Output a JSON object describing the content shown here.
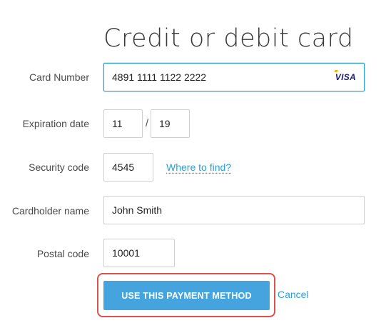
{
  "form": {
    "title": "Credit or debit card",
    "card_number": {
      "label": "Card Number",
      "value": "4891 1111 1122 2222",
      "brand": "VISA"
    },
    "expiration": {
      "label": "Expiration date",
      "month": "11",
      "separator": "/",
      "year": "19"
    },
    "security_code": {
      "label": "Security code",
      "value": "4545",
      "help_link": "Where to find?"
    },
    "cardholder": {
      "label": "Cardholder name",
      "value": "John Smith"
    },
    "postal": {
      "label": "Postal code",
      "value": "10001"
    },
    "actions": {
      "submit_label": "USE THIS PAYMENT METHOD",
      "cancel_label": "Cancel"
    }
  },
  "colors": {
    "accent": "#45a4dd",
    "link": "#2a9fd8",
    "highlight": "#d9534f",
    "card_brand": "#1a1f71"
  }
}
